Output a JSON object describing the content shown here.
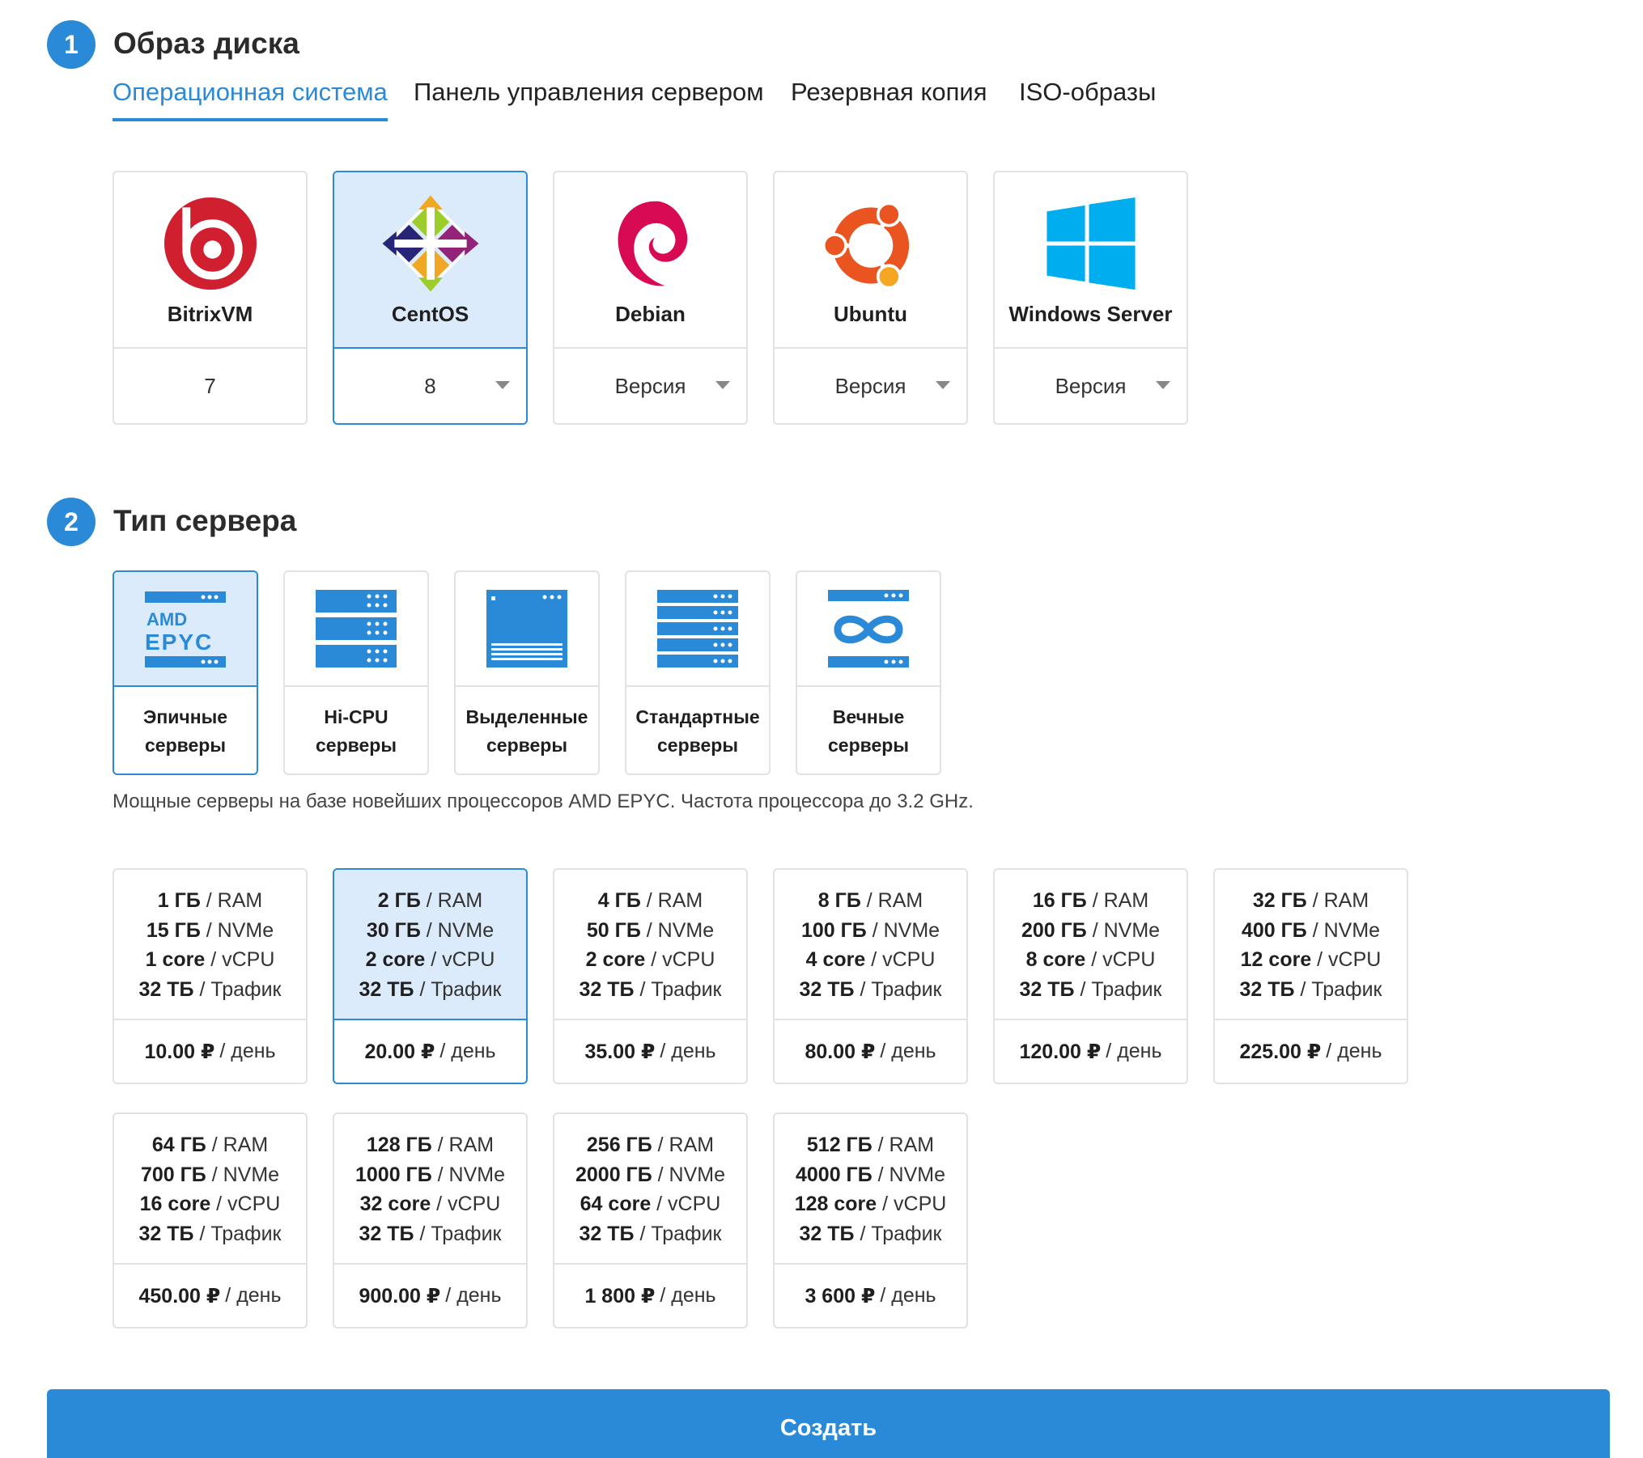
{
  "section1": {
    "number": "1",
    "title": "Образ диска"
  },
  "tabs": [
    {
      "label": "Операционная система",
      "active": true
    },
    {
      "label": "Панель управления сервером",
      "active": false
    },
    {
      "label": "Резервная копия",
      "active": false
    },
    {
      "label": "ISO-образы",
      "active": false
    }
  ],
  "os": [
    {
      "name": "BitrixVM",
      "version": "7",
      "has_dropdown": false,
      "selected": false,
      "icon": "bitrix-logo-icon"
    },
    {
      "name": "CentOS",
      "version": "8",
      "has_dropdown": true,
      "selected": true,
      "icon": "centos-logo-icon"
    },
    {
      "name": "Debian",
      "version": "Версия",
      "has_dropdown": true,
      "selected": false,
      "icon": "debian-logo-icon"
    },
    {
      "name": "Ubuntu",
      "version": "Версия",
      "has_dropdown": true,
      "selected": false,
      "icon": "ubuntu-logo-icon"
    },
    {
      "name": "Windows Server",
      "version": "Версия",
      "has_dropdown": true,
      "selected": false,
      "icon": "windows-logo-icon"
    }
  ],
  "section2": {
    "number": "2",
    "title": "Тип сервера"
  },
  "server_types": [
    {
      "line1": "Эпичные",
      "line2": "серверы",
      "selected": true,
      "icon": "amd-epyc-icon",
      "logo_text": [
        "AMD",
        "EPYC"
      ]
    },
    {
      "line1": "Hi-CPU",
      "line2": "серверы",
      "selected": false,
      "icon": "hi-cpu-server-icon"
    },
    {
      "line1": "Выделенные",
      "line2": "серверы",
      "selected": false,
      "icon": "dedicated-server-icon"
    },
    {
      "line1": "Стандартные",
      "line2": "серверы",
      "selected": false,
      "icon": "standard-server-icon"
    },
    {
      "line1": "Вечные",
      "line2": "серверы",
      "selected": false,
      "icon": "infinity-server-icon"
    }
  ],
  "description": "Мощные серверы на базе новейших процессоров AMD EPYC. Частота процессора до 3.2 GHz.",
  "plans": [
    {
      "ram": "1 ГБ",
      "disk": "15 ГБ",
      "cpu": "1 core",
      "traffic": "32 ТБ",
      "price": "10.00 ₽",
      "selected": false
    },
    {
      "ram": "2 ГБ",
      "disk": "30 ГБ",
      "cpu": "2 core",
      "traffic": "32 ТБ",
      "price": "20.00 ₽",
      "selected": true
    },
    {
      "ram": "4 ГБ",
      "disk": "50 ГБ",
      "cpu": "2 core",
      "traffic": "32 ТБ",
      "price": "35.00 ₽",
      "selected": false
    },
    {
      "ram": "8 ГБ",
      "disk": "100 ГБ",
      "cpu": "4 core",
      "traffic": "32 ТБ",
      "price": "80.00 ₽",
      "selected": false
    },
    {
      "ram": "16 ГБ",
      "disk": "200 ГБ",
      "cpu": "8 core",
      "traffic": "32 ТБ",
      "price": "120.00 ₽",
      "selected": false
    },
    {
      "ram": "32 ГБ",
      "disk": "400 ГБ",
      "cpu": "12 core",
      "traffic": "32 ТБ",
      "price": "225.00 ₽",
      "selected": false
    },
    {
      "ram": "64 ГБ",
      "disk": "700 ГБ",
      "cpu": "16 core",
      "traffic": "32 ТБ",
      "price": "450.00 ₽",
      "selected": false
    },
    {
      "ram": "128 ГБ",
      "disk": "1000 ГБ",
      "cpu": "32 core",
      "traffic": "32 ТБ",
      "price": "900.00 ₽",
      "selected": false
    },
    {
      "ram": "256 ГБ",
      "disk": "2000 ГБ",
      "cpu": "64 core",
      "traffic": "32 ТБ",
      "price": "1 800 ₽",
      "selected": false
    },
    {
      "ram": "512 ГБ",
      "disk": "4000 ГБ",
      "cpu": "128 core",
      "traffic": "32 ТБ",
      "price": "3 600 ₽",
      "selected": false
    }
  ],
  "plan_units": {
    "ram": "RAM",
    "disk": "NVMe",
    "cpu": "vCPU",
    "traffic": "Трафик",
    "period": "день",
    "sep": "/"
  },
  "create_button": "Создать",
  "colors": {
    "accent": "#2a8ad8",
    "selected_bg": "#dcebfb",
    "border": "#e2e2e2"
  }
}
